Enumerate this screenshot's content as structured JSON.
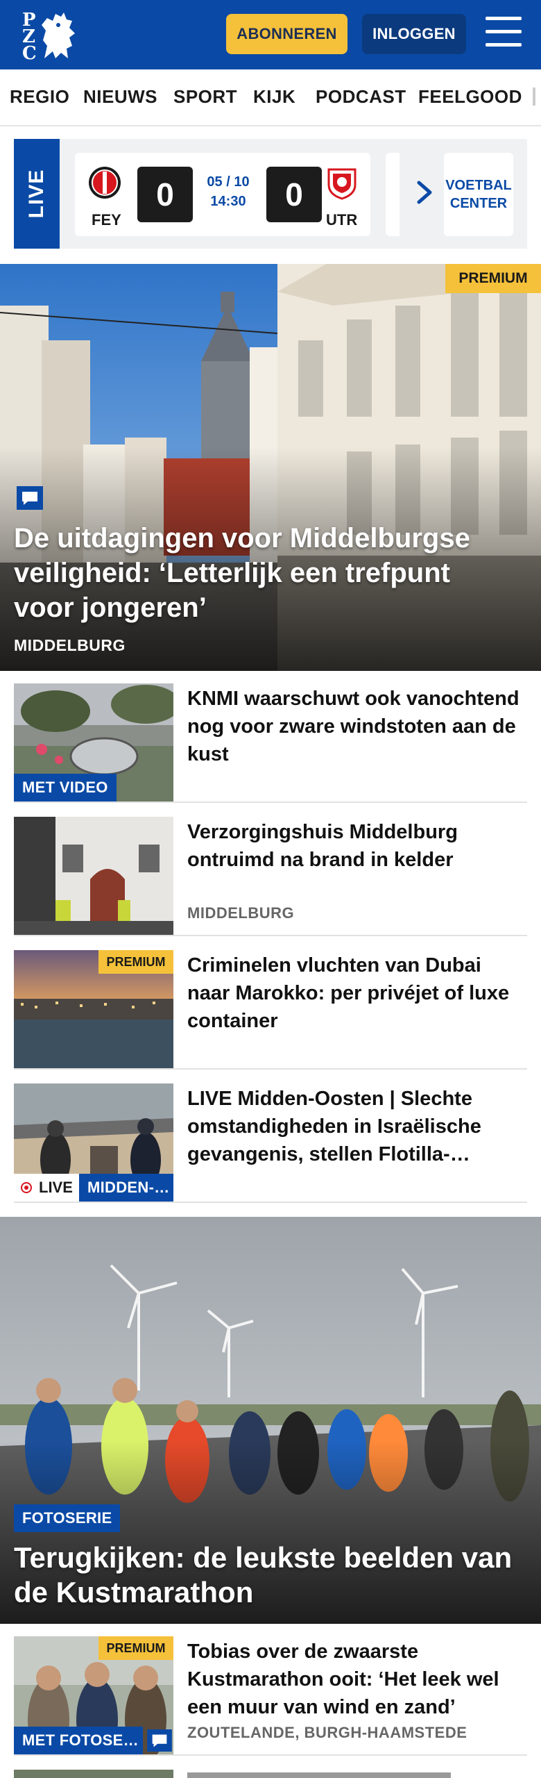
{
  "header": {
    "logo_letters": [
      "P",
      "Z",
      "C"
    ],
    "subscribe_label": "ABONNEREN",
    "login_label": "INLOGGEN",
    "brand_color": "#0a4aa6",
    "accent_color": "#f5c13a"
  },
  "nav": {
    "items": [
      {
        "label": "REGIO"
      },
      {
        "label": "NIEUWS"
      },
      {
        "label": "SPORT"
      },
      {
        "label": "KIJK"
      },
      {
        "label": "PODCAST"
      },
      {
        "label": "FEELGOOD"
      }
    ]
  },
  "live": {
    "label": "LIVE",
    "match": {
      "home": "FEY",
      "away": "UTR",
      "home_score": "0",
      "away_score": "0",
      "date": "05 / 10",
      "time": "14:30"
    },
    "cta_label": "VOETBAL CENTER"
  },
  "hero": {
    "badge": "PREMIUM",
    "title": "De uitdagingen voor Middelburgse veiligheid: ‘Letterlijk een trefpunt voor jongeren’",
    "location": "MIDDELBURG"
  },
  "articles": [
    {
      "title": "KNMI waarschuwt ook vanochtend nog voor zware windstoten aan de kust",
      "tag": "MET VIDEO"
    },
    {
      "title": "Verzorgingshuis Middelburg ontruimd na brand in kelder",
      "meta": "MIDDELBURG"
    },
    {
      "title": "Criminelen vluchten van Dubai naar Marokko: per privéjet of luxe container",
      "badge": "PREMIUM"
    },
    {
      "title": "LIVE Midden-Oosten | Slechte omstandigheden in Israëlische gevangenis, stellen Flotilla-…",
      "live_label": "LIVE",
      "tag": "MIDDEN-…"
    }
  ],
  "hero2": {
    "tag": "FOTOSERIE",
    "title": "Terugkijken: de leukste beelden van de Kustmarathon"
  },
  "article_after": {
    "title": "Tobias over de zwaarste Kustmarathon ooit: ‘Het leek wel een muur van wind en zand’",
    "meta": "ZOUTELANDE, BURGH-HAAMSTEDE",
    "badge": "PREMIUM",
    "tag": "MET FOTOSE…"
  }
}
